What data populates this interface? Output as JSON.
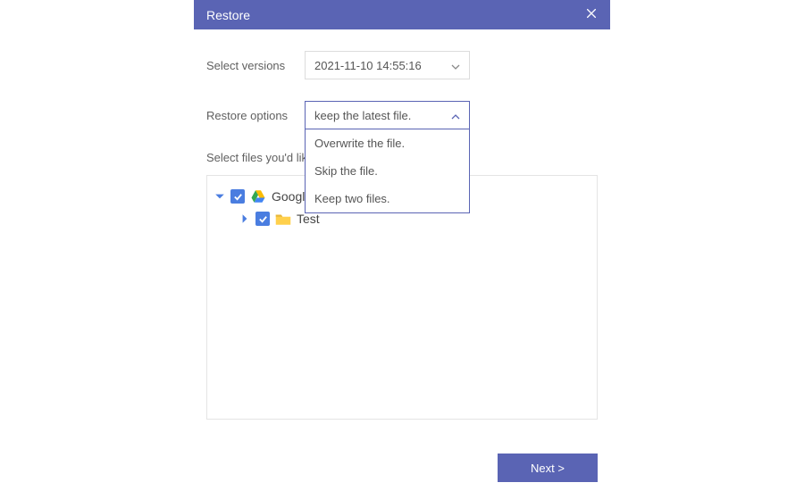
{
  "header": {
    "title": "Restore"
  },
  "form": {
    "version_label": "Select versions",
    "version_value": "2021-11-10 14:55:16",
    "options_label": "Restore options",
    "options_selected": "keep the latest file.",
    "options_list": [
      "Overwrite the file.",
      "Skip the file.",
      "Keep two files."
    ]
  },
  "section": {
    "files_label": "Select files you'd like to restore:"
  },
  "tree": {
    "root_label": "Google Drive",
    "child_label": "Test"
  },
  "footer": {
    "next_label": "Next >"
  }
}
